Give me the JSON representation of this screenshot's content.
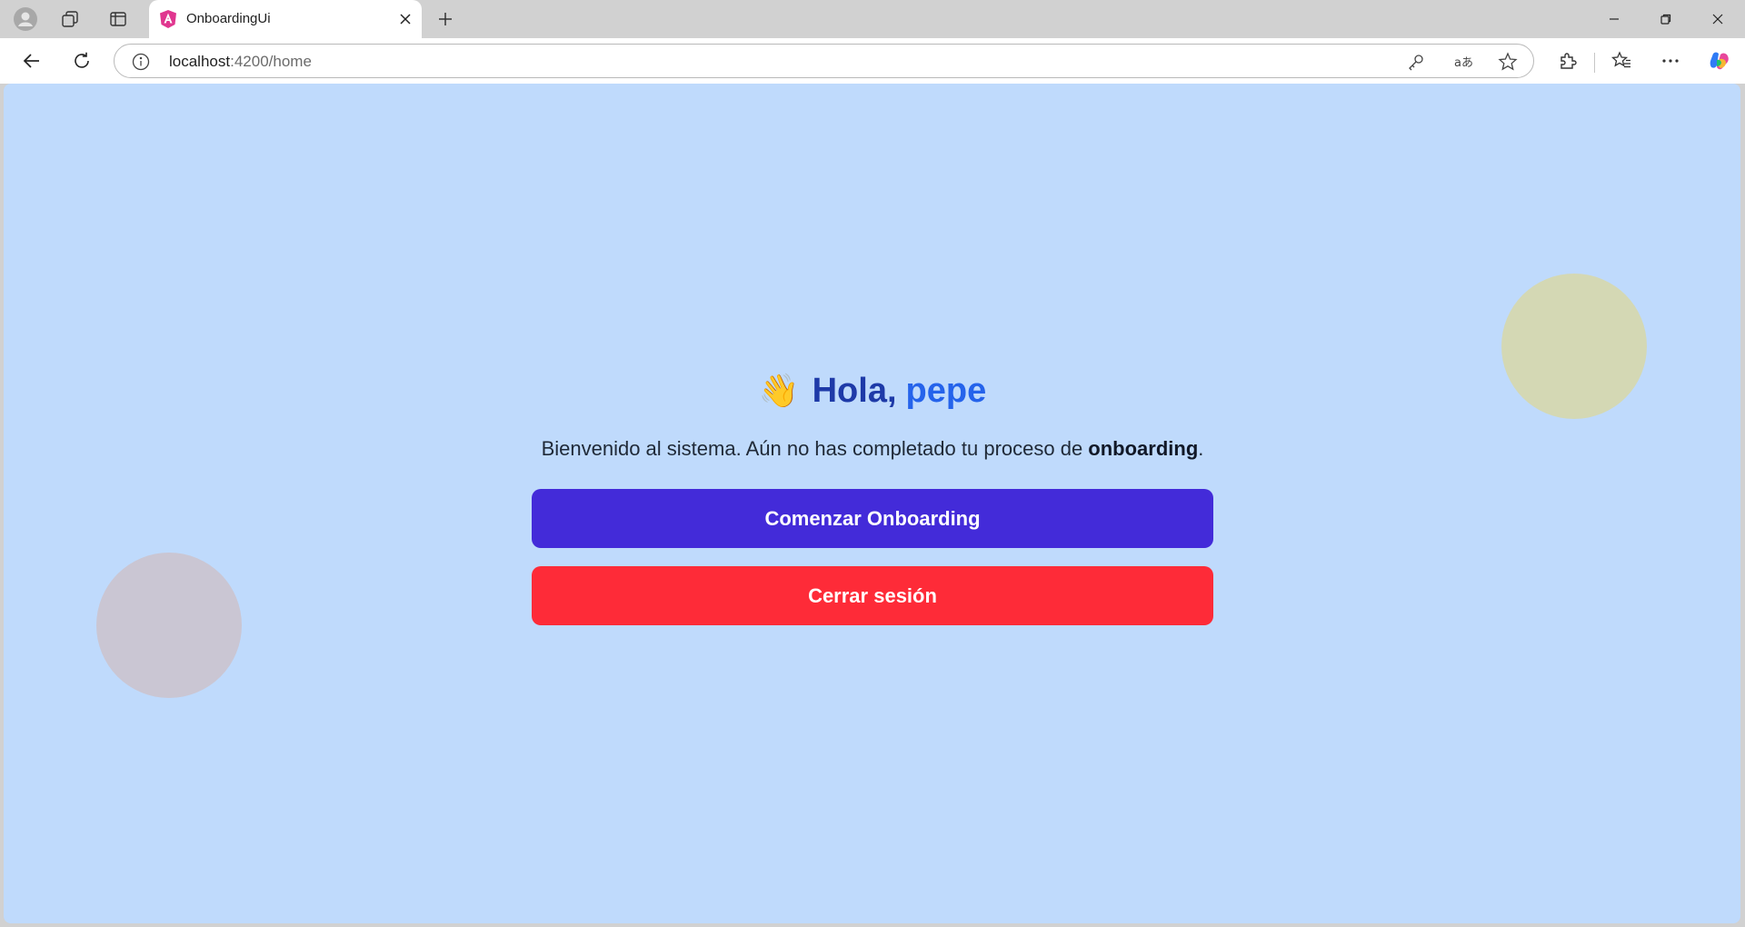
{
  "browser": {
    "tab": {
      "title": "OnboardingUi"
    },
    "address": {
      "host": "localhost",
      "path": ":4200/home"
    },
    "icons": {
      "profile": "profile-icon",
      "workspaces": "workspaces-icon",
      "vertical_tabs": "vertical-tabs-icon",
      "favicon": "angular-logo-icon",
      "close_tab": "close-icon",
      "new_tab": "plus-icon",
      "back": "back-arrow-icon",
      "reload": "reload-icon",
      "site_info": "info-icon",
      "password": "key-icon",
      "translate": "translate-icon",
      "favorite": "star-icon",
      "extensions": "puzzle-icon",
      "favorites_list": "favorites-icon",
      "more": "more-icon",
      "copilot": "copilot-icon",
      "minimize": "minimize-icon",
      "restore": "restore-icon",
      "close_window": "close-icon"
    }
  },
  "page": {
    "greeting": {
      "emoji": "👋",
      "prefix": "Hola,",
      "name": "pepe"
    },
    "welcome": {
      "text_before": "Bienvenido al sistema. Aún no has completado tu proceso de ",
      "highlight": "onboarding",
      "text_after": "."
    },
    "buttons": {
      "start": "Comenzar Onboarding",
      "logout": "Cerrar sesión"
    },
    "colors": {
      "background": "#bfdafc",
      "primary_button": "#432bd9",
      "danger_button": "#fe2b38",
      "greeting": "#1e3aa8",
      "name": "#2563eb",
      "blob_yellow": "#d4d8b4",
      "blob_pink": "#cac6d3"
    }
  }
}
